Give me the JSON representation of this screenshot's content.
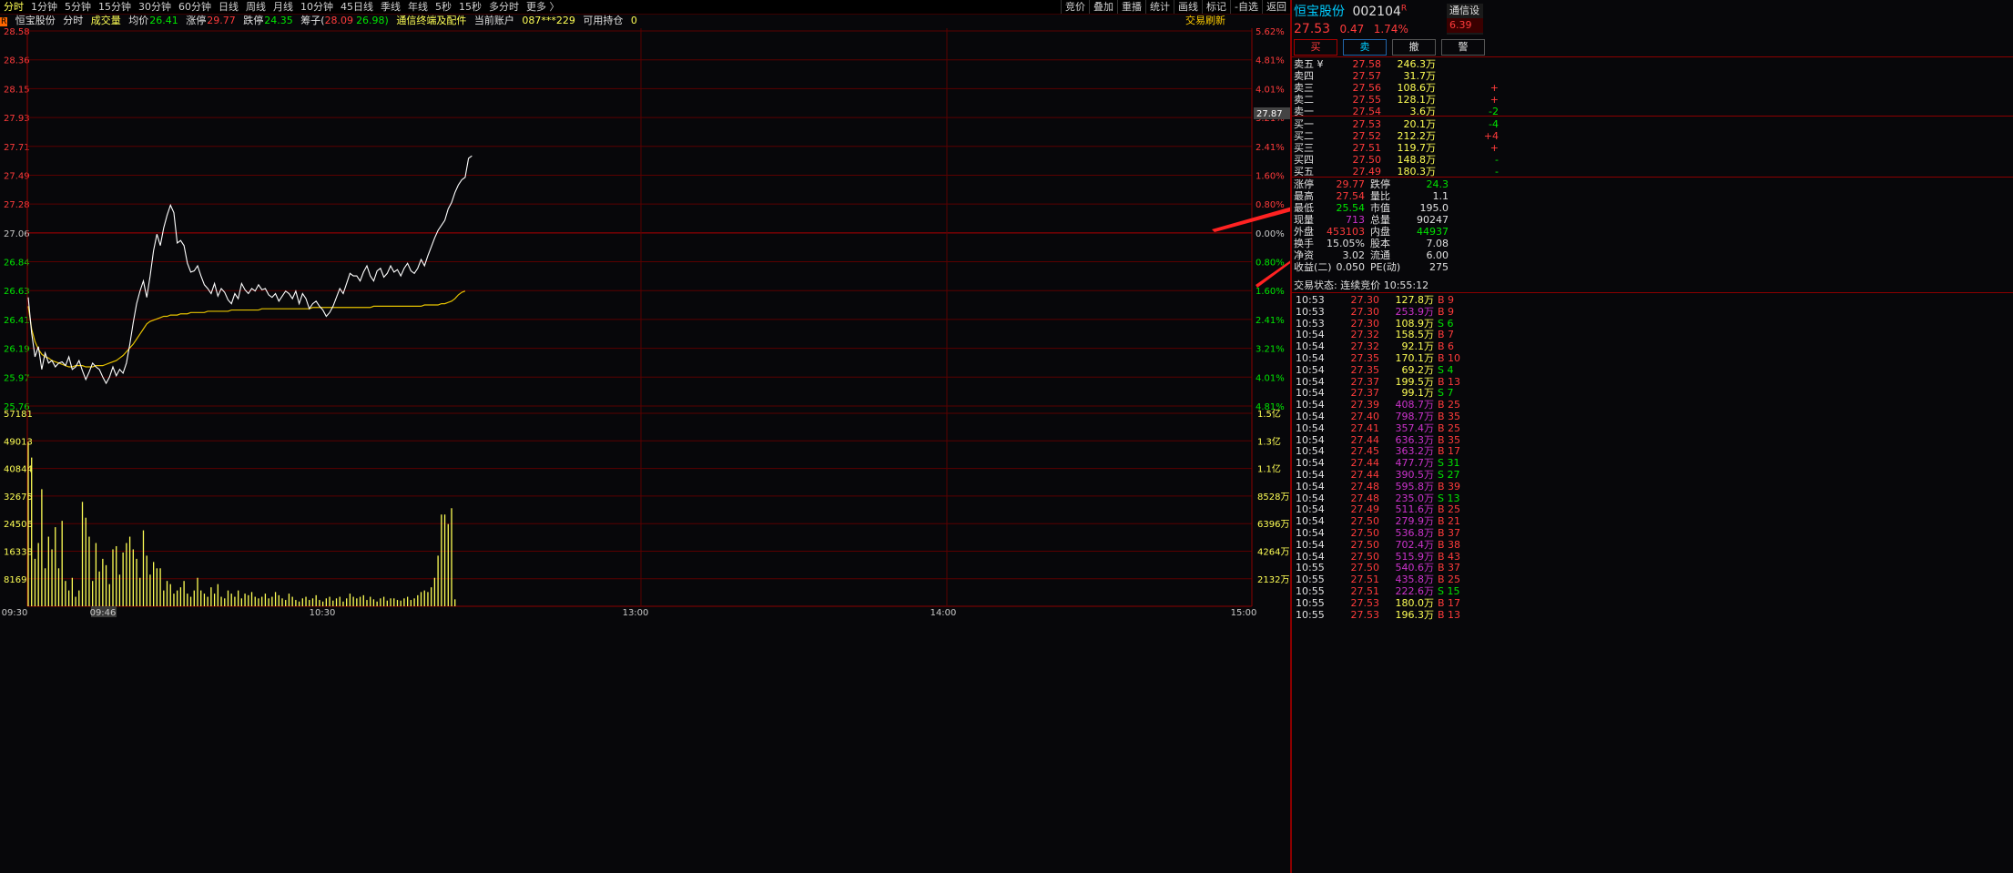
{
  "toolbar": {
    "tabs": [
      "分时",
      "1分钟",
      "5分钟",
      "15分钟",
      "30分钟",
      "60分钟",
      "日线",
      "周线",
      "月线",
      "10分钟",
      "45日线",
      "季线",
      "年线",
      "5秒",
      "15秒",
      "多分时",
      "更多 〉"
    ],
    "active": 0,
    "tools": [
      "竞价",
      "叠加",
      "重播",
      "统计",
      "画线",
      "标记",
      "-自选",
      "返回"
    ]
  },
  "info": {
    "badge": "R",
    "name": "恒宝股份",
    "mode": "分时",
    "volume_label": "成交量",
    "avg_label": "均价",
    "avg": "26.41",
    "limit_up_label": "涨停",
    "limit_up": "29.77",
    "limit_down_label": "跌停",
    "limit_down": "24.35",
    "chip_label": "筹子(",
    "chip_a": "28.09",
    "chip_b": "26.98)",
    "sector": "通信终端及配件",
    "account_label": "当前账户",
    "account": "087***229",
    "hold_label": "可用持仓",
    "hold": "0",
    "refresh": "交易刷新"
  },
  "chart_data": {
    "type": "line",
    "title": "恒宝股份 分时",
    "prev_close": 27.06,
    "ylim": [
      25.54,
      28.58
    ],
    "price_ticks": [
      "28.58",
      "28.36",
      "28.15",
      "27.93",
      "27.71",
      "27.49",
      "27.28",
      "27.06",
      "26.84",
      "26.63",
      "26.41",
      "26.19",
      "25.97",
      "25.76"
    ],
    "pct_ticks": [
      "5.62%",
      "4.81%",
      "4.01%",
      "3.21%",
      "2.41%",
      "1.60%",
      "0.80%",
      "0.00%",
      "0.80%",
      "1.60%",
      "2.41%",
      "3.21%",
      "4.01%",
      "4.81%"
    ],
    "vol_ticks": [
      "57181",
      "49013",
      "40844",
      "32675",
      "24506",
      "16338",
      "8169"
    ],
    "amt_ticks": [
      "1.5亿",
      "1.3亿",
      "1.1亿",
      "8528万",
      "6396万",
      "4264万",
      "2132万"
    ],
    "time_ticks": [
      "09:30",
      "09:46",
      "10:30",
      "13:00",
      "14:00",
      "15:00"
    ],
    "current_price_label": "27.87",
    "price": [
      26.45,
      26.17,
      25.98,
      26.06,
      25.88,
      26.01,
      25.93,
      25.95,
      25.9,
      25.93,
      25.94,
      25.91,
      25.98,
      25.88,
      25.9,
      25.95,
      25.87,
      25.8,
      25.86,
      25.93,
      25.9,
      25.88,
      25.82,
      25.77,
      25.82,
      25.9,
      25.83,
      25.88,
      25.85,
      25.93,
      26.08,
      26.25,
      26.4,
      26.5,
      26.58,
      26.45,
      26.62,
      26.82,
      26.95,
      26.86,
      27.0,
      27.1,
      27.18,
      27.12,
      26.88,
      26.9,
      26.86,
      26.72,
      26.65,
      26.66,
      26.7,
      26.62,
      26.55,
      26.52,
      26.48,
      26.56,
      26.46,
      26.52,
      26.49,
      26.43,
      26.4,
      26.48,
      26.44,
      26.56,
      26.51,
      26.48,
      26.52,
      26.5,
      26.55,
      26.51,
      26.52,
      26.47,
      26.45,
      26.48,
      26.42,
      26.46,
      26.5,
      26.48,
      26.44,
      26.5,
      26.4,
      26.48,
      26.44,
      26.36,
      26.4,
      26.42,
      26.38,
      26.35,
      26.3,
      26.33,
      26.38,
      26.45,
      26.52,
      26.48,
      26.56,
      26.64,
      26.62,
      26.62,
      26.58,
      26.65,
      26.7,
      26.62,
      26.58,
      26.66,
      26.68,
      26.61,
      26.64,
      26.7,
      26.65,
      26.67,
      26.62,
      26.68,
      26.72,
      26.66,
      26.64,
      26.68,
      26.75,
      26.7,
      26.78,
      26.85,
      26.92,
      26.98,
      27.02,
      27.06,
      27.15,
      27.2,
      27.28,
      27.34,
      27.38,
      27.4,
      27.55,
      27.57
    ],
    "avg": [
      26.38,
      26.2,
      26.1,
      26.04,
      26.0,
      25.98,
      25.97,
      25.95,
      25.94,
      25.93,
      25.92,
      25.91,
      25.9,
      25.9,
      25.91,
      25.91,
      25.91,
      25.9,
      25.9,
      25.9,
      25.91,
      25.91,
      25.91,
      25.92,
      25.93,
      25.94,
      25.95,
      25.97,
      25.99,
      26.02,
      26.05,
      26.08,
      26.12,
      26.16,
      26.2,
      26.24,
      26.26,
      26.27,
      26.28,
      26.29,
      26.3,
      26.3,
      26.31,
      26.31,
      26.31,
      26.32,
      26.32,
      26.32,
      26.33,
      26.33,
      26.33,
      26.33,
      26.33,
      26.34,
      26.34,
      26.34,
      26.34,
      26.34,
      26.34,
      26.34,
      26.35,
      26.35,
      26.35,
      26.35,
      26.35,
      26.35,
      26.35,
      26.35,
      26.35,
      26.36,
      26.36,
      26.36,
      26.36,
      26.36,
      26.36,
      26.36,
      26.36,
      26.36,
      26.36,
      26.36,
      26.36,
      26.36,
      26.36,
      26.36,
      26.37,
      26.37,
      26.37,
      26.37,
      26.37,
      26.37,
      26.37,
      26.37,
      26.37,
      26.37,
      26.37,
      26.37,
      26.37,
      26.37,
      26.37,
      26.37,
      26.37,
      26.37,
      26.38,
      26.38,
      26.38,
      26.38,
      26.38,
      26.38,
      26.38,
      26.38,
      26.38,
      26.38,
      26.38,
      26.38,
      26.38,
      26.38,
      26.38,
      26.39,
      26.39,
      26.39,
      26.39,
      26.39,
      26.4,
      26.4,
      26.41,
      26.42,
      26.44,
      26.47,
      26.49,
      26.5
    ],
    "volume": [
      52000,
      47000,
      15000,
      20000,
      37000,
      12000,
      22000,
      18000,
      25000,
      12000,
      27000,
      8000,
      5000,
      9000,
      3000,
      5000,
      33000,
      28000,
      22000,
      8000,
      20000,
      11000,
      15000,
      13000,
      7000,
      18000,
      19000,
      10000,
      17000,
      20000,
      22000,
      18000,
      15000,
      9000,
      24000,
      16000,
      10000,
      14000,
      12000,
      12000,
      5000,
      8000,
      7000,
      4000,
      5000,
      6000,
      8000,
      4000,
      3000,
      5000,
      9000,
      5000,
      4000,
      3000,
      6000,
      4000,
      7000,
      3000,
      2500,
      5000,
      4000,
      3000,
      5000,
      2500,
      4000,
      3500,
      4500,
      3000,
      2500,
      3000,
      4000,
      2500,
      3000,
      4500,
      3500,
      2500,
      2000,
      4000,
      3000,
      2000,
      1500,
      2500,
      3000,
      2000,
      2500,
      3500,
      2000,
      1500,
      2500,
      3000,
      1800,
      2500,
      3000,
      1500,
      2500,
      4000,
      3000,
      2500,
      3000,
      3500,
      2000,
      3000,
      2200,
      1500,
      2500,
      3000,
      1800,
      2500,
      2500,
      2000,
      1800,
      2500,
      3000,
      2000,
      2500,
      3500,
      4500,
      5000,
      4500,
      6000,
      9000,
      16000,
      29000,
      29000,
      26000,
      31000,
      2200
    ]
  },
  "quote": {
    "name": "恒宝股份",
    "code": "002104",
    "mark": "R",
    "price": "27.53",
    "change": "0.47",
    "pct": "1.74%",
    "right_name": "通信设",
    "right_pct": "6.39",
    "buttons": [
      "买",
      "卖",
      "撤",
      "警"
    ],
    "asks": [
      {
        "label": "卖五 ¥",
        "price": "27.58",
        "vol": "246.3万",
        "diff": ""
      },
      {
        "label": "卖四",
        "price": "27.57",
        "vol": "31.7万",
        "diff": ""
      },
      {
        "label": "卖三",
        "price": "27.56",
        "vol": "108.6万",
        "diff": "+"
      },
      {
        "label": "卖二",
        "price": "27.55",
        "vol": "128.1万",
        "diff": "+"
      },
      {
        "label": "卖一",
        "price": "27.54",
        "vol": "3.6万",
        "diff": "-2"
      }
    ],
    "bids": [
      {
        "label": "买一",
        "price": "27.53",
        "vol": "20.1万",
        "diff": "-4"
      },
      {
        "label": "买二",
        "price": "27.52",
        "vol": "212.2万",
        "diff": "+4"
      },
      {
        "label": "买三",
        "price": "27.51",
        "vol": "119.7万",
        "diff": "+"
      },
      {
        "label": "买四",
        "price": "27.50",
        "vol": "148.8万",
        "diff": "-"
      },
      {
        "label": "买五",
        "price": "27.49",
        "vol": "180.3万",
        "diff": "-"
      }
    ],
    "stats": [
      {
        "k1": "涨停",
        "v1": "29.77",
        "k2": "跌停",
        "v2": "24.3"
      },
      {
        "k1": "最高",
        "v1": "27.54",
        "k2": "量比",
        "v2": "1.1"
      },
      {
        "k1": "最低",
        "v1": "25.54",
        "k2": "市值",
        "v2": "195.0"
      },
      {
        "k1": "现量",
        "v1": "713",
        "k2": "总量",
        "v2": "90247"
      },
      {
        "k1": "外盘",
        "v1": "453103",
        "k2": "内盘",
        "v2": "44937"
      },
      {
        "k1": "换手",
        "v1": "15.05%",
        "k2": "股本",
        "v2": "7.08"
      },
      {
        "k1": "净资",
        "v1": "3.02",
        "k2": "流通",
        "v2": "6.00"
      },
      {
        "k1": "收益(二)",
        "v1": "0.050",
        "k2": "PE(动)",
        "v2": "275"
      }
    ],
    "status": "交易状态: 连续竞价 10:55:12",
    "ticks": [
      {
        "t": "10:53",
        "p": "27.30",
        "v": "127.8万",
        "s": "B",
        "n": "9"
      },
      {
        "t": "10:53",
        "p": "27.30",
        "v": "253.9万",
        "s": "B",
        "n": "9"
      },
      {
        "t": "10:53",
        "p": "27.30",
        "v": "108.9万",
        "s": "S",
        "n": "6"
      },
      {
        "t": "10:54",
        "p": "27.32",
        "v": "158.5万",
        "s": "B",
        "n": "7"
      },
      {
        "t": "10:54",
        "p": "27.32",
        "v": "92.1万",
        "s": "B",
        "n": "6"
      },
      {
        "t": "10:54",
        "p": "27.35",
        "v": "170.1万",
        "s": "B",
        "n": "10"
      },
      {
        "t": "10:54",
        "p": "27.35",
        "v": "69.2万",
        "s": "S",
        "n": "4"
      },
      {
        "t": "10:54",
        "p": "27.37",
        "v": "199.5万",
        "s": "B",
        "n": "13"
      },
      {
        "t": "10:54",
        "p": "27.37",
        "v": "99.1万",
        "s": "S",
        "n": "7"
      },
      {
        "t": "10:54",
        "p": "27.39",
        "v": "408.7万",
        "s": "B",
        "n": "25"
      },
      {
        "t": "10:54",
        "p": "27.40",
        "v": "798.7万",
        "s": "B",
        "n": "35"
      },
      {
        "t": "10:54",
        "p": "27.41",
        "v": "357.4万",
        "s": "B",
        "n": "25"
      },
      {
        "t": "10:54",
        "p": "27.44",
        "v": "636.3万",
        "s": "B",
        "n": "35"
      },
      {
        "t": "10:54",
        "p": "27.45",
        "v": "363.2万",
        "s": "B",
        "n": "17"
      },
      {
        "t": "10:54",
        "p": "27.44",
        "v": "477.7万",
        "s": "S",
        "n": "31"
      },
      {
        "t": "10:54",
        "p": "27.44",
        "v": "390.5万",
        "s": "S",
        "n": "27"
      },
      {
        "t": "10:54",
        "p": "27.48",
        "v": "595.8万",
        "s": "B",
        "n": "39"
      },
      {
        "t": "10:54",
        "p": "27.48",
        "v": "235.0万",
        "s": "S",
        "n": "13"
      },
      {
        "t": "10:54",
        "p": "27.49",
        "v": "511.6万",
        "s": "B",
        "n": "25"
      },
      {
        "t": "10:54",
        "p": "27.50",
        "v": "279.9万",
        "s": "B",
        "n": "21"
      },
      {
        "t": "10:54",
        "p": "27.50",
        "v": "536.8万",
        "s": "B",
        "n": "37"
      },
      {
        "t": "10:54",
        "p": "27.50",
        "v": "702.4万",
        "s": "B",
        "n": "38"
      },
      {
        "t": "10:54",
        "p": "27.50",
        "v": "515.9万",
        "s": "B",
        "n": "43"
      },
      {
        "t": "10:55",
        "p": "27.50",
        "v": "540.6万",
        "s": "B",
        "n": "37"
      },
      {
        "t": "10:55",
        "p": "27.51",
        "v": "435.8万",
        "s": "B",
        "n": "25"
      },
      {
        "t": "10:55",
        "p": "27.51",
        "v": "222.6万",
        "s": "S",
        "n": "15"
      },
      {
        "t": "10:55",
        "p": "27.53",
        "v": "180.0万",
        "s": "B",
        "n": "17"
      },
      {
        "t": "10:55",
        "p": "27.53",
        "v": "196.3万",
        "s": "B",
        "n": "13"
      }
    ]
  }
}
